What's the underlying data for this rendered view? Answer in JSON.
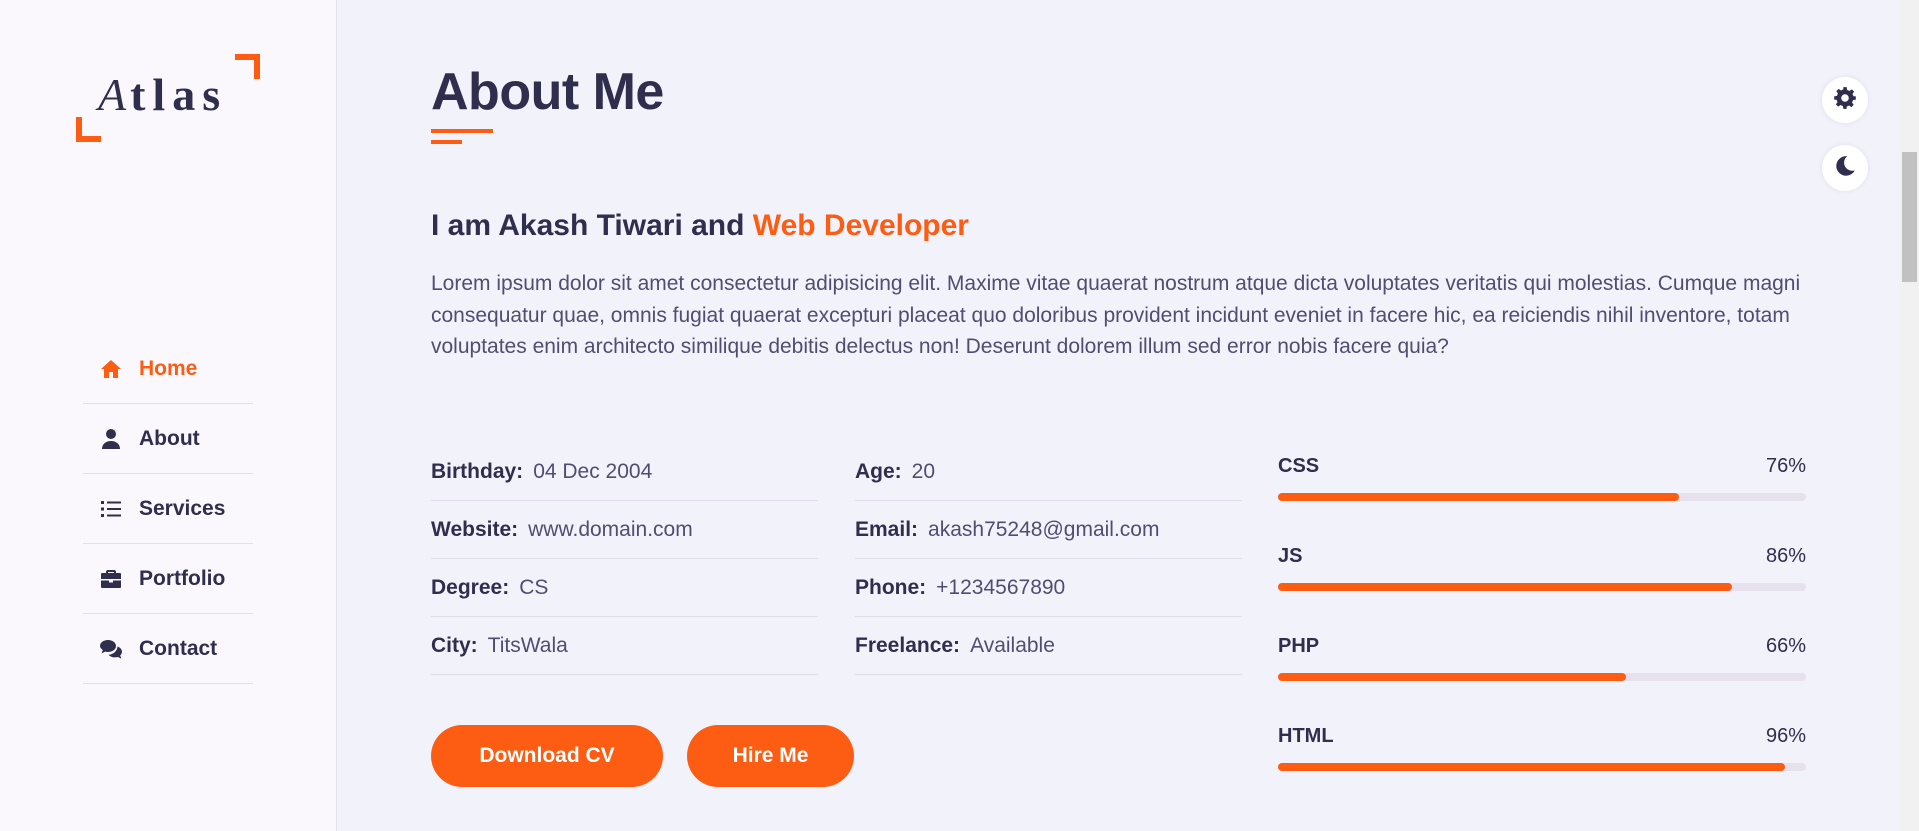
{
  "brand": {
    "logo_first": "A",
    "logo_rest": "tlas"
  },
  "nav": {
    "items": [
      {
        "label": "Home",
        "icon": "home-icon",
        "active": true
      },
      {
        "label": "About",
        "icon": "user-icon",
        "active": false
      },
      {
        "label": "Services",
        "icon": "list-icon",
        "active": false
      },
      {
        "label": "Portfolio",
        "icon": "briefcase-icon",
        "active": false
      },
      {
        "label": "Contact",
        "icon": "comments-icon",
        "active": false
      }
    ]
  },
  "main": {
    "title": "About Me",
    "intro_prefix": "I am Akash Tiwari and ",
    "intro_role": "Web Developer",
    "intro_text": "Lorem ipsum dolor sit amet consectetur adipisicing elit. Maxime vitae quaerat nostrum atque dicta voluptates veritatis qui molestias. Cumque magni consequatur quae, omnis fugiat quaerat excepturi placeat quo doloribus provident incidunt eveniet in facere hic, ea reiciendis nihil inventore, totam voluptates enim architecto similique debitis delectus non! Deserunt dolorem illum sed error nobis facere quia?",
    "info_left": [
      {
        "key": "Birthday:",
        "value": "04 Dec 2004"
      },
      {
        "key": "Website:",
        "value": "www.domain.com"
      },
      {
        "key": "Degree:",
        "value": "CS"
      },
      {
        "key": "City:",
        "value": "TitsWala"
      }
    ],
    "info_right": [
      {
        "key": "Age:",
        "value": "20"
      },
      {
        "key": "Email:",
        "value": "akash75248@gmail.com"
      },
      {
        "key": "Phone:",
        "value": "+1234567890"
      },
      {
        "key": "Freelance:",
        "value": "Available"
      }
    ],
    "buttons": {
      "download": "Download CV",
      "hire": "Hire Me"
    },
    "skills": [
      {
        "name": "CSS",
        "percent_label": "76%",
        "level": 0.76
      },
      {
        "name": "JS",
        "percent_label": "86%",
        "level": 0.86
      },
      {
        "name": "PHP",
        "percent_label": "66%",
        "level": 0.66
      },
      {
        "name": "HTML",
        "percent_label": "96%",
        "level": 0.96
      }
    ]
  },
  "toggles": {
    "settings_icon": "gear-icon",
    "theme_icon": "moon-icon"
  },
  "colors": {
    "accent": "#fd5c13",
    "text_dark": "#302e4d",
    "background": "#f2f2fb",
    "sidebar": "#fbf8fd"
  }
}
